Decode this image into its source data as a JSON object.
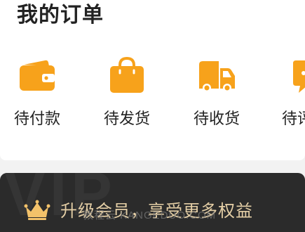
{
  "orders": {
    "title": "我的订单",
    "items": [
      {
        "label": "待付款",
        "icon": "wallet-icon"
      },
      {
        "label": "待发货",
        "icon": "shopping-bag-icon"
      },
      {
        "label": "待收货",
        "icon": "delivery-truck-icon"
      },
      {
        "label": "待评",
        "icon": "comment-icon"
      }
    ]
  },
  "vip": {
    "watermark_text": "VIP",
    "banner_text": "升级会员，享受更多权益",
    "icon": "crown-icon"
  },
  "site_watermark": "教程云 KANGEDUO.COM",
  "colors": {
    "accent_orange": "#F7A21B",
    "icon_detail": "#FFFFFF",
    "vip_background": "#2B2B2B",
    "vip_gold": "#E5CFA6"
  }
}
